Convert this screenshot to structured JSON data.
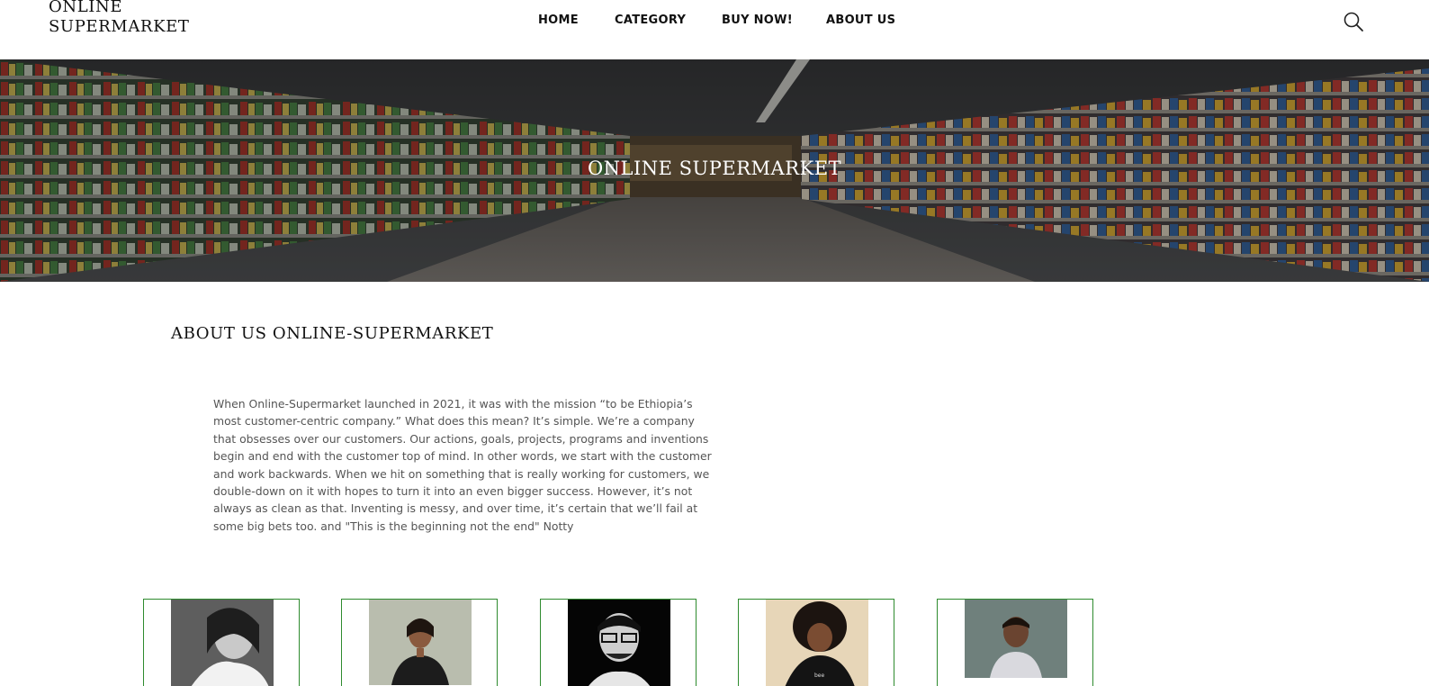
{
  "brand": {
    "line1": "ONLINE",
    "line2": "SUPERMARKET"
  },
  "nav": {
    "items": [
      {
        "label": "HOME"
      },
      {
        "label": "CATEGORY"
      },
      {
        "label": "BUY NOW!"
      },
      {
        "label": "ABOUT US"
      }
    ]
  },
  "header": {
    "search_icon": "search-icon"
  },
  "hero": {
    "title": "ONLINE SUPERMARKET",
    "image": "supermarket-aisle"
  },
  "about": {
    "heading": "ABOUT US ONLINE-SUPERMARKET",
    "body": "When Online-Supermarket launched in 2021, it was with the mission “to be Ethiopia’s most customer-centric company.” What does this mean? It’s simple. We’re a company that obsesses over our customers. Our actions, goals, projects, programs and inventions begin and end with the customer top of mind. In other words, we start with the customer and work backwards. When we hit on something that is really working for customers, we double-down on it with hopes to turn it into an even bigger success. However, it’s not always as clean as that. Inventing is messy, and over time, it’s certain that we’ll fail at some big bets too. and \"This is the beginning not the end\" Notty"
  },
  "team": {
    "members": [
      {
        "photo": "team-member-photo-1"
      },
      {
        "photo": "team-member-photo-2"
      },
      {
        "photo": "team-member-photo-3"
      },
      {
        "photo": "team-member-photo-4"
      },
      {
        "photo": "team-member-photo-5"
      }
    ]
  },
  "colors": {
    "card_border": "#2e8b2e",
    "hero_text": "#ffffff",
    "body_text": "#555555"
  }
}
